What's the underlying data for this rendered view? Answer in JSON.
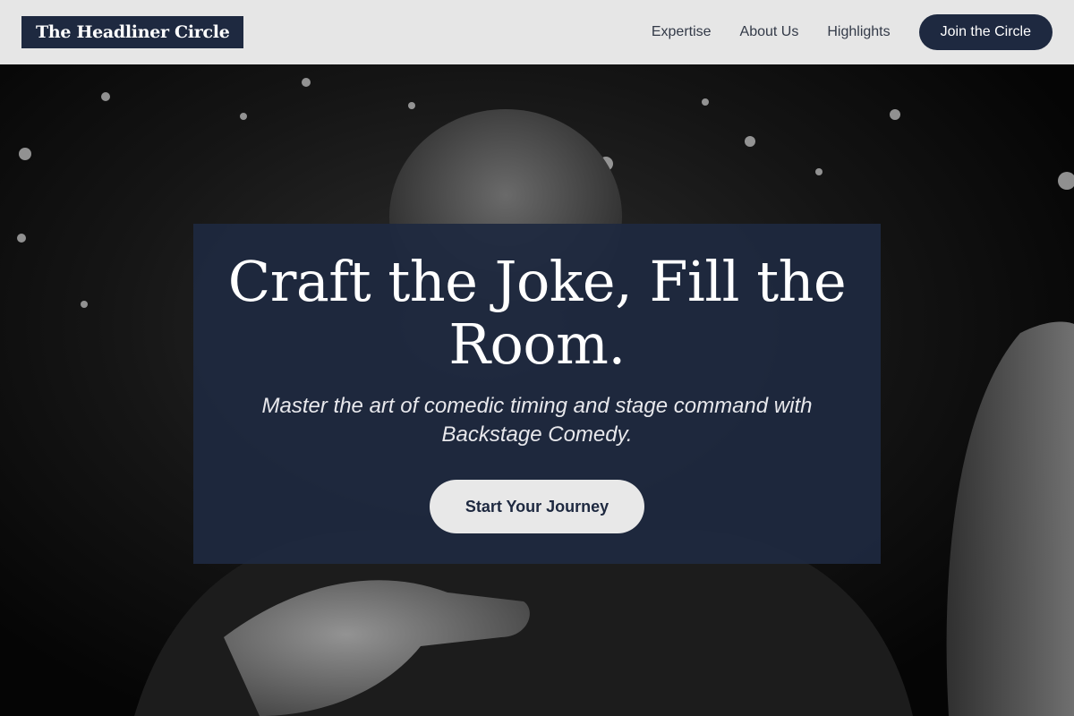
{
  "header": {
    "logo": "The Headliner Circle",
    "nav": [
      "Expertise",
      "About Us",
      "Highlights"
    ],
    "cta": "Join the Circle"
  },
  "hero": {
    "title_line1": "Craft the Joke, Fill the",
    "title_line2": "Room.",
    "subtitle": "Master the art of comedic timing and stage command with Backstage Comedy.",
    "cta": "Start Your Journey",
    "image_alt": "black-and-white photo of a comedian pointing at the camera"
  },
  "colors": {
    "navy": "#1e2940",
    "header_bg": "#e6e6e6",
    "button_light": "#e8e8e8"
  }
}
